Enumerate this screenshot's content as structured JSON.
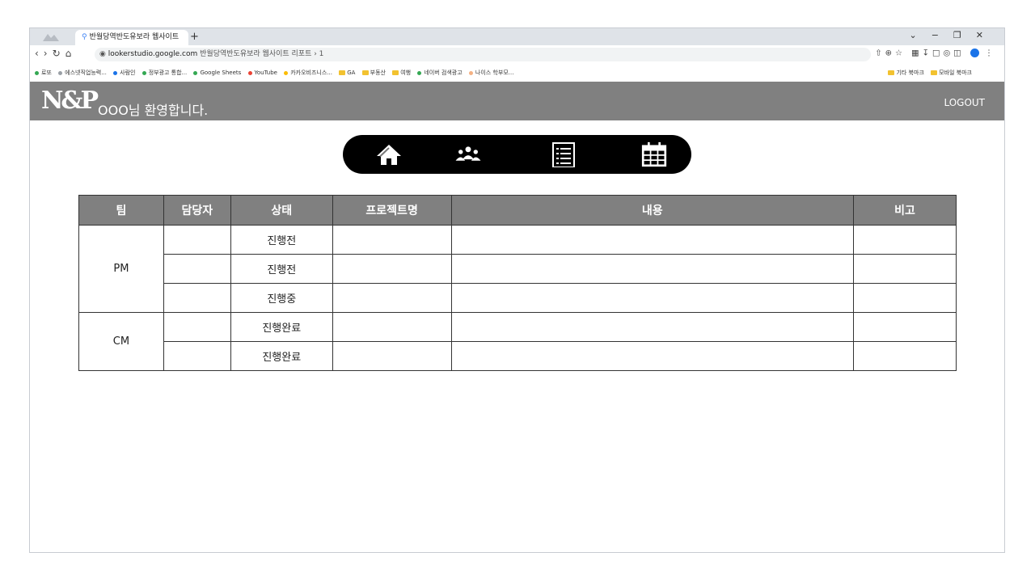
{
  "browser": {
    "tab_title": "반월당역반도유보라 웹사이트",
    "new_tab": "+",
    "url_host": "lookerstudio.google.com",
    "url_rest": "반월당역반도유보라 웹사이트 리포트 › 1",
    "bookmarks": [
      {
        "label": "로또",
        "color": "#34a853"
      },
      {
        "label": "에스넷직업능력...",
        "color": "#9aa0a6"
      },
      {
        "label": "사람인",
        "color": "#1a73e8"
      },
      {
        "label": "정부광고 통합...",
        "color": "#34a853"
      },
      {
        "label": "Google Sheets",
        "color": "#34a853"
      },
      {
        "label": "YouTube",
        "color": "#ea4335"
      },
      {
        "label": "카카오비즈니스...",
        "color": "#fbbc04"
      }
    ],
    "bookmark_folders": [
      "GA",
      "부동산",
      "여행"
    ],
    "bookmarks2": [
      {
        "label": "네이버 검색광고",
        "color": "#34a853"
      },
      {
        "label": "나이스 학부모...",
        "color": "#f4b183"
      }
    ],
    "bookmark_right": [
      "기타 북마크",
      "모바일 북마크"
    ]
  },
  "header": {
    "logo": "N&P",
    "welcome": "OOO님 환영합니다.",
    "logout": "LOGOUT",
    "bg_color": "#808080"
  },
  "nav": {
    "icons": [
      "home-icon",
      "users-icon",
      "list-icon",
      "calendar-icon"
    ]
  },
  "table": {
    "headers": [
      "팀",
      "담당자",
      "상태",
      "프로젝트명",
      "내용",
      "비고"
    ],
    "teams": [
      "PM",
      "CM"
    ],
    "statuses": [
      "진행전",
      "진행전",
      "진행중",
      "진행완료",
      "진행완료"
    ]
  }
}
